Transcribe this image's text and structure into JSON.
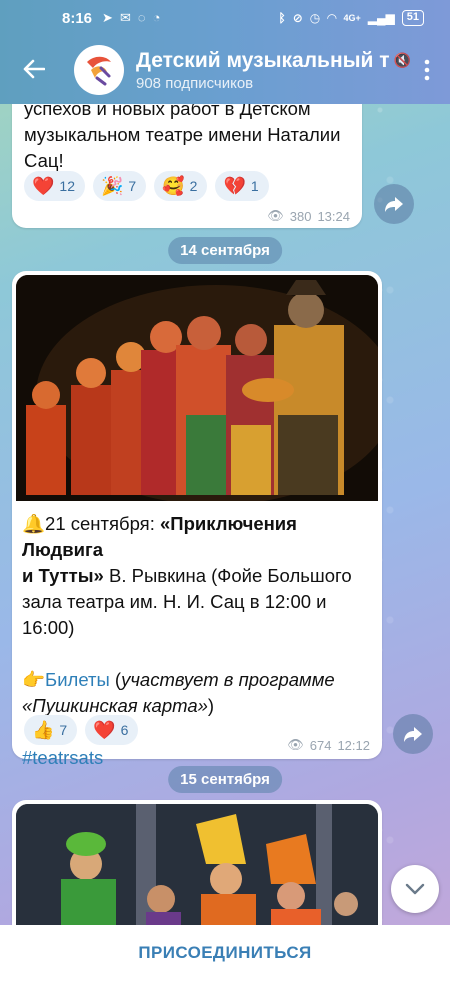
{
  "status_bar": {
    "time": "8:16",
    "left_icons": [
      "telegram-icon",
      "mail-icon",
      "whatsapp-icon",
      "cast-icon"
    ],
    "right_icons": [
      "bluetooth-icon",
      "mute-icon",
      "alarm-icon",
      "wifi-icon",
      "signal-icon"
    ],
    "network": "4G+",
    "battery": "51"
  },
  "header": {
    "back_icon": "arrow-left-icon",
    "title": "Детский музыкальный т",
    "subscribers": "908 подписчиков",
    "menu_icon": "more-vertical-icon"
  },
  "messages": [
    {
      "text_lines": [
        "успехов и новых работ в Детском",
        "музыкальном театре имени Наталии",
        "Сац!"
      ],
      "reactions": [
        {
          "emoji": "❤️",
          "count": "12"
        },
        {
          "emoji": "🎉",
          "count": "7"
        },
        {
          "emoji": "🥰",
          "count": "2"
        },
        {
          "emoji": "💔",
          "count": "1"
        }
      ],
      "views": "380",
      "time": "13:24"
    },
    {
      "date": "14 сентября",
      "line1_prefix": "🔔21 сентября: ",
      "line1_bold": "«Приключения Людвига",
      "line2_bold": "и Тутты»",
      "line2_rest": " В. Рывкина (Фойе Большого",
      "line3": "зала театра им. Н. И. Сац в 12:00 и",
      "line4": "16:00)",
      "tickets_emoji": "👉",
      "tickets_link": "Билеты",
      "tickets_rest_a": " (",
      "tickets_italic": "участвует в программе",
      "tickets_italic2": "«Пушкинская карта»",
      "tickets_close": ")",
      "hashtag": "#teatrsats",
      "reactions": [
        {
          "emoji": "👍",
          "count": "7"
        },
        {
          "emoji": "❤️",
          "count": "6"
        }
      ],
      "views": "674",
      "time": "12:12"
    },
    {
      "date": "15 сентября"
    }
  ],
  "join_label": "ПРИСОЕДИНИТЬСЯ"
}
